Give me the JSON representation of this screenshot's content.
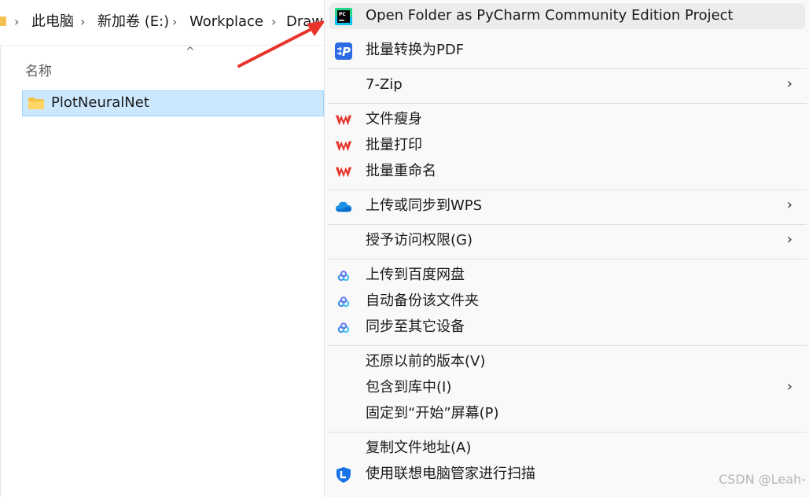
{
  "breadcrumb": {
    "items": [
      "此电脑",
      "新加卷 (E:)",
      "Workplace",
      "Draw"
    ]
  },
  "file_list": {
    "sort_indicator": "^",
    "column_name": "名称",
    "rows": [
      {
        "name": "PlotNeuralNet",
        "icon": "folder-icon",
        "selected": true
      }
    ]
  },
  "context_menu": {
    "items": [
      {
        "label": "Open Folder as PyCharm Community Edition Project",
        "icon": "pycharm-icon",
        "submenu": false
      },
      {
        "label": "批量转换为PDF",
        "icon": "pdf-convert-icon",
        "submenu": false
      },
      {
        "label": "7-Zip",
        "icon": "",
        "submenu": true
      },
      {
        "label": "文件瘦身",
        "icon": "wps-icon",
        "submenu": false
      },
      {
        "label": "批量打印",
        "icon": "wps-icon",
        "submenu": false
      },
      {
        "label": "批量重命名",
        "icon": "wps-icon",
        "submenu": false
      },
      {
        "label": "上传或同步到WPS",
        "icon": "cloud-icon",
        "submenu": true
      },
      {
        "label": "授予访问权限(G)",
        "icon": "",
        "submenu": true
      },
      {
        "label": "上传到百度网盘",
        "icon": "baidu-netdisk-icon",
        "submenu": false
      },
      {
        "label": "自动备份该文件夹",
        "icon": "baidu-netdisk-icon",
        "submenu": false
      },
      {
        "label": "同步至其它设备",
        "icon": "baidu-netdisk-icon",
        "submenu": false
      },
      {
        "label": "还原以前的版本(V)",
        "icon": "",
        "submenu": false
      },
      {
        "label": "包含到库中(I)",
        "icon": "",
        "submenu": true
      },
      {
        "label": "固定到“开始”屏幕(P)",
        "icon": "",
        "submenu": false
      },
      {
        "label": "复制文件地址(A)",
        "icon": "",
        "submenu": false
      },
      {
        "label": "使用联想电脑管家进行扫描",
        "icon": "lenovo-shield-icon",
        "submenu": false
      }
    ],
    "submenu_glyph": "›"
  },
  "watermark": "CSDN @Leah-",
  "colors": {
    "selection_bg": "#cce8ff",
    "wps_red": "#e8342a",
    "pdf_blue": "#2b6be6",
    "arrow_red": "#e8342a"
  }
}
